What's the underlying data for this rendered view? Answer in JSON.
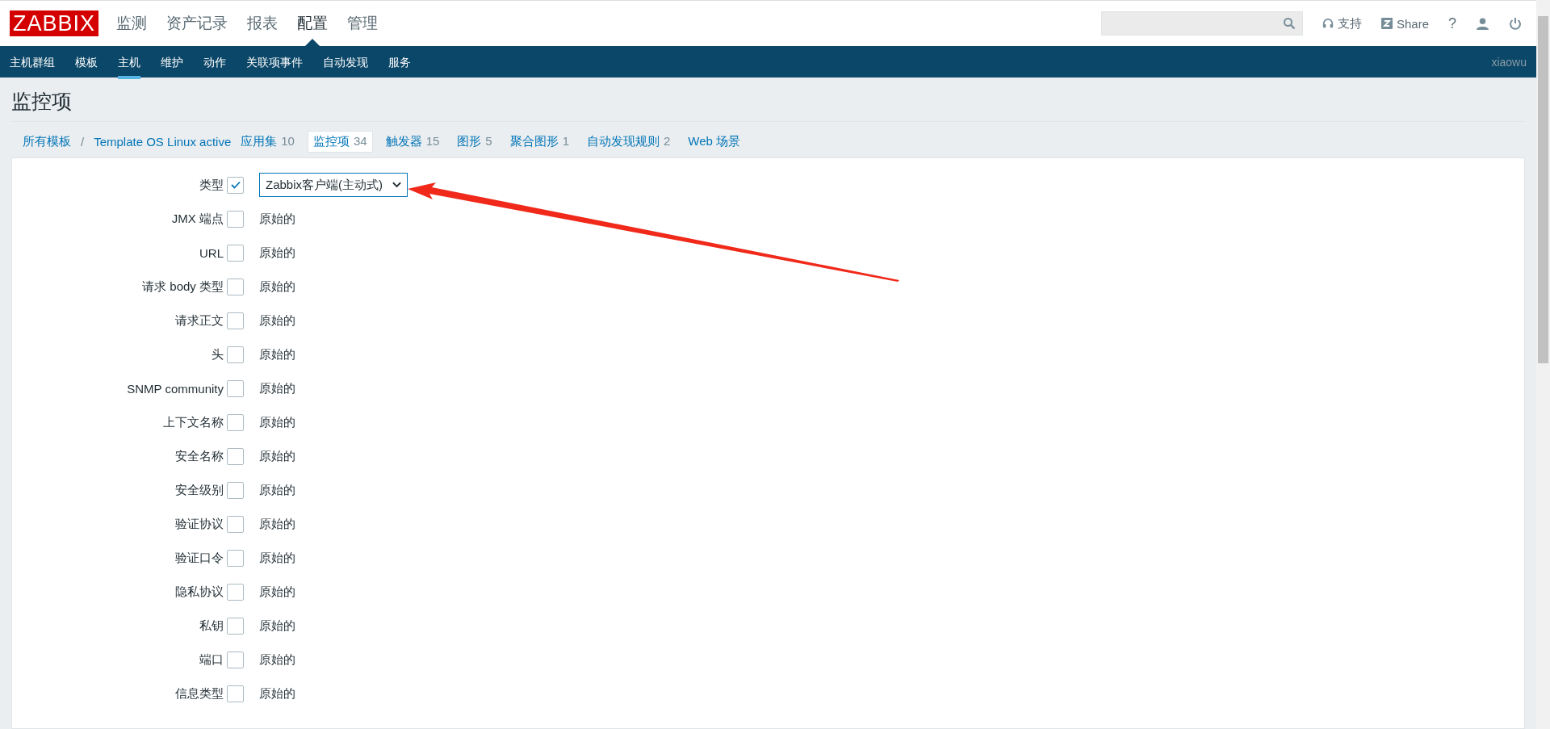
{
  "header": {
    "logo": "ZABBIX",
    "menu": [
      {
        "label": "监测",
        "selected": false
      },
      {
        "label": "资产记录",
        "selected": false
      },
      {
        "label": "报表",
        "selected": false
      },
      {
        "label": "配置",
        "selected": true
      },
      {
        "label": "管理",
        "selected": false
      }
    ],
    "support": "支持",
    "share": "Share",
    "help": "?"
  },
  "subnav": {
    "items": [
      {
        "label": "主机群组",
        "selected": false
      },
      {
        "label": "模板",
        "selected": false
      },
      {
        "label": "主机",
        "selected": true
      },
      {
        "label": "维护",
        "selected": false
      },
      {
        "label": "动作",
        "selected": false
      },
      {
        "label": "关联项事件",
        "selected": false
      },
      {
        "label": "自动发现",
        "selected": false
      },
      {
        "label": "服务",
        "selected": false
      }
    ],
    "user": "xiaowu"
  },
  "page_title": "监控项",
  "breadcrumb": [
    {
      "label": "所有模板",
      "selected": false,
      "kind": "link",
      "separator": "/"
    },
    {
      "label": "Template OS Linux active",
      "selected": false,
      "kind": "link"
    },
    {
      "label": "应用集",
      "count": "10",
      "selected": false,
      "kind": "tab"
    },
    {
      "label": "监控项",
      "count": "34",
      "selected": true,
      "kind": "tab"
    },
    {
      "label": "触发器",
      "count": "15",
      "selected": false,
      "kind": "tab"
    },
    {
      "label": "图形",
      "count": "5",
      "selected": false,
      "kind": "tab"
    },
    {
      "label": "聚合图形",
      "count": "1",
      "selected": false,
      "kind": "tab"
    },
    {
      "label": "自动发现规则",
      "count": "2",
      "selected": false,
      "kind": "tab"
    },
    {
      "label": "Web 场景",
      "selected": false,
      "kind": "tab"
    }
  ],
  "fields": [
    {
      "label": "类型",
      "checked": true,
      "kind": "select",
      "value": "Zabbix客户端(主动式)"
    },
    {
      "label": "JMX 端点",
      "checked": false,
      "kind": "text",
      "value": "原始的"
    },
    {
      "label": "URL",
      "checked": false,
      "kind": "text",
      "value": "原始的"
    },
    {
      "label": "请求 body 类型",
      "checked": false,
      "kind": "text",
      "value": "原始的"
    },
    {
      "label": "请求正文",
      "checked": false,
      "kind": "text",
      "value": "原始的"
    },
    {
      "label": "头",
      "checked": false,
      "kind": "text",
      "value": "原始的"
    },
    {
      "label": "SNMP community",
      "checked": false,
      "kind": "text",
      "value": "原始的"
    },
    {
      "label": "上下文名称",
      "checked": false,
      "kind": "text",
      "value": "原始的"
    },
    {
      "label": "安全名称",
      "checked": false,
      "kind": "text",
      "value": "原始的"
    },
    {
      "label": "安全级别",
      "checked": false,
      "kind": "text",
      "value": "原始的"
    },
    {
      "label": "验证协议",
      "checked": false,
      "kind": "text",
      "value": "原始的"
    },
    {
      "label": "验证口令",
      "checked": false,
      "kind": "text",
      "value": "原始的"
    },
    {
      "label": "隐私协议",
      "checked": false,
      "kind": "text",
      "value": "原始的"
    },
    {
      "label": "私钥",
      "checked": false,
      "kind": "text",
      "value": "原始的"
    },
    {
      "label": "端口",
      "checked": false,
      "kind": "text",
      "value": "原始的"
    },
    {
      "label": "信息类型",
      "checked": false,
      "kind": "text",
      "value": "原始的"
    }
  ]
}
